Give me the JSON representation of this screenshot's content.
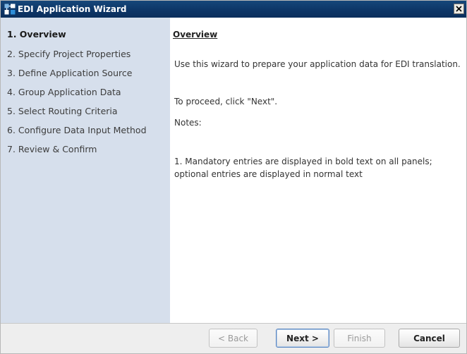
{
  "window": {
    "title": "EDI Application Wizard",
    "close_glyph": "✕",
    "icons": {
      "app": "wizard-app-icon",
      "close": "close-icon"
    }
  },
  "sidebar": {
    "steps": [
      {
        "label": "1. Overview",
        "active": true
      },
      {
        "label": "2. Specify Project Properties",
        "active": false
      },
      {
        "label": "3. Define Application Source",
        "active": false
      },
      {
        "label": "4. Group Application Data",
        "active": false
      },
      {
        "label": "5. Select Routing Criteria",
        "active": false
      },
      {
        "label": "6. Configure Data Input Method",
        "active": false
      },
      {
        "label": "7. Review & Confirm",
        "active": false
      }
    ]
  },
  "content": {
    "title": "Overview",
    "paragraphs": [
      "Use this wizard to prepare your application data for EDI translation.",
      "To proceed, click \"Next\".",
      "Notes:",
      "1. Mandatory entries are displayed in bold text on all panels; optional entries are displayed in normal text"
    ]
  },
  "footer": {
    "back_label": "< Back",
    "next_label": "Next >",
    "finish_label": "Finish",
    "cancel_label": "Cancel"
  },
  "colors": {
    "titlebar": "#0d3566",
    "sidebar": "#d6dfec",
    "footer": "#eeeeee",
    "default_button_border": "#5a86c2"
  }
}
